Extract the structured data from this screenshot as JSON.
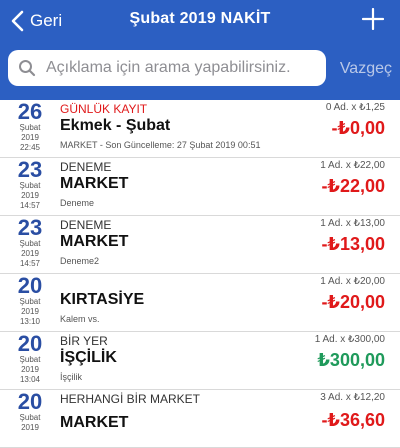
{
  "header": {
    "back_label": "Geri",
    "title": "Şubat 2019  NAKİT",
    "add_icon": "plus-icon",
    "back_icon": "chevron-left-icon",
    "background_color": "#2c5fc2"
  },
  "search": {
    "placeholder": "Açıklama için arama yapabilirsiniz.",
    "value": "",
    "cancel_label": "Vazgeç",
    "icon": "search-icon"
  },
  "transactions": [
    {
      "day": "26",
      "month": "Şubat",
      "year": "2019",
      "time": "22:45",
      "category": "GÜNLÜK KAYIT",
      "category_color": "#e0191a",
      "name": "Ekmek - Şubat",
      "note": "MARKET - Son Güncelleme: 27 Şubat 2019 00:51",
      "qty": "0 Ad. x ₺1,25",
      "amount": "-₺0,00",
      "amount_color": "#e0191a"
    },
    {
      "day": "23",
      "month": "Şubat",
      "year": "2019",
      "time": "14:57",
      "category": "DENEME",
      "name": "MARKET",
      "note": "Deneme",
      "qty": "1 Ad. x ₺22,00",
      "amount": "-₺22,00",
      "amount_color": "#e0191a"
    },
    {
      "day": "23",
      "month": "Şubat",
      "year": "2019",
      "time": "14:57",
      "category": "DENEME",
      "name": "MARKET",
      "note": "Deneme2",
      "qty": "1 Ad. x ₺13,00",
      "amount": "-₺13,00",
      "amount_color": "#e0191a"
    },
    {
      "day": "20",
      "month": "Şubat",
      "year": "2019",
      "time": "13:10",
      "category": "",
      "name": "KIRTASİYE",
      "note": "Kalem vs.",
      "qty": "1 Ad. x ₺20,00",
      "amount": "-₺20,00",
      "amount_color": "#e0191a"
    },
    {
      "day": "20",
      "month": "Şubat",
      "year": "2019",
      "time": "13:04",
      "category": "BİR YER",
      "name": "İŞÇİLİK",
      "note": "İşçilik",
      "qty": "1 Ad. x ₺300,00",
      "amount": "₺300,00",
      "amount_color": "#1f9a5b"
    },
    {
      "day": "20",
      "month": "Şubat",
      "year": "2019",
      "time": "",
      "category": "HERHANGİ BİR MARKET",
      "name": "MARKET",
      "note": "",
      "qty": "3 Ad. x ₺12,20",
      "amount": "-₺36,60",
      "amount_color": "#e0191a"
    }
  ]
}
